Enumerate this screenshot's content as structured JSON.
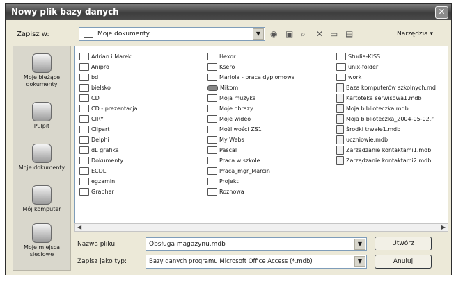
{
  "window": {
    "title": "Nowy plik bazy danych",
    "close_glyph": "✕"
  },
  "toolbar": {
    "save_in_label": "Zapisz w:",
    "save_in_value": "Moje dokumenty",
    "tools_label": "Narzędzia ▾",
    "icons": [
      "back-icon",
      "up-folder-icon",
      "search-web-icon",
      "delete-icon",
      "new-folder-icon",
      "views-icon"
    ]
  },
  "places": [
    {
      "label": "Moje bieżące dokumenty",
      "icon": "recent-documents-icon"
    },
    {
      "label": "Pulpit",
      "icon": "desktop-icon"
    },
    {
      "label": "Moje dokumenty",
      "icon": "my-documents-icon"
    },
    {
      "label": "Mój komputer",
      "icon": "my-computer-icon"
    },
    {
      "label": "Moje miejsca sieciowe",
      "icon": "network-places-icon"
    }
  ],
  "files": {
    "column1": [
      "Adrian i Marek",
      "Anipro",
      "bd",
      "bielsko",
      "CD",
      "CD - prezentacja",
      "CIRY",
      "Clipart",
      "Delphi",
      "dL grafika",
      "Dokumenty",
      "ECDL",
      "egzamin",
      "Grapher"
    ],
    "column2": [
      "Hexor",
      "Ksero",
      "Mariola - praca dyplomowa",
      "Mikom",
      "Moja muzyka",
      "Moje obrazy",
      "Moje wideo",
      "Możliwości ZS1",
      "My Webs",
      "Pascal",
      "Praca w szkole",
      "Praca_mgr_Marcin",
      "Projekt",
      "Roznowa"
    ],
    "column3": [
      "Studia-KISS",
      "unix-folder",
      "work",
      "Baza komputerów szkolnych.md",
      "Kartoteka serwisowa1.mdb",
      "Moja biblioteczka.mdb",
      "Moja biblioteczka_2004-05-02.r",
      "Środki trwałe1.mdb",
      "uczniowie.mdb",
      "Zarządzanie kontaktami1.mdb",
      "Zarządzanie kontaktami2.mdb"
    ]
  },
  "form": {
    "filename_label": "Nazwa pliku:",
    "filename_value": "Obsługa magazynu.mdb",
    "filetype_label": "Zapisz jako typ:",
    "filetype_value": "Bazy danych programu Microsoft Office Access (*.mdb)"
  },
  "buttons": {
    "create": "Utwórz",
    "cancel": "Anuluj"
  }
}
